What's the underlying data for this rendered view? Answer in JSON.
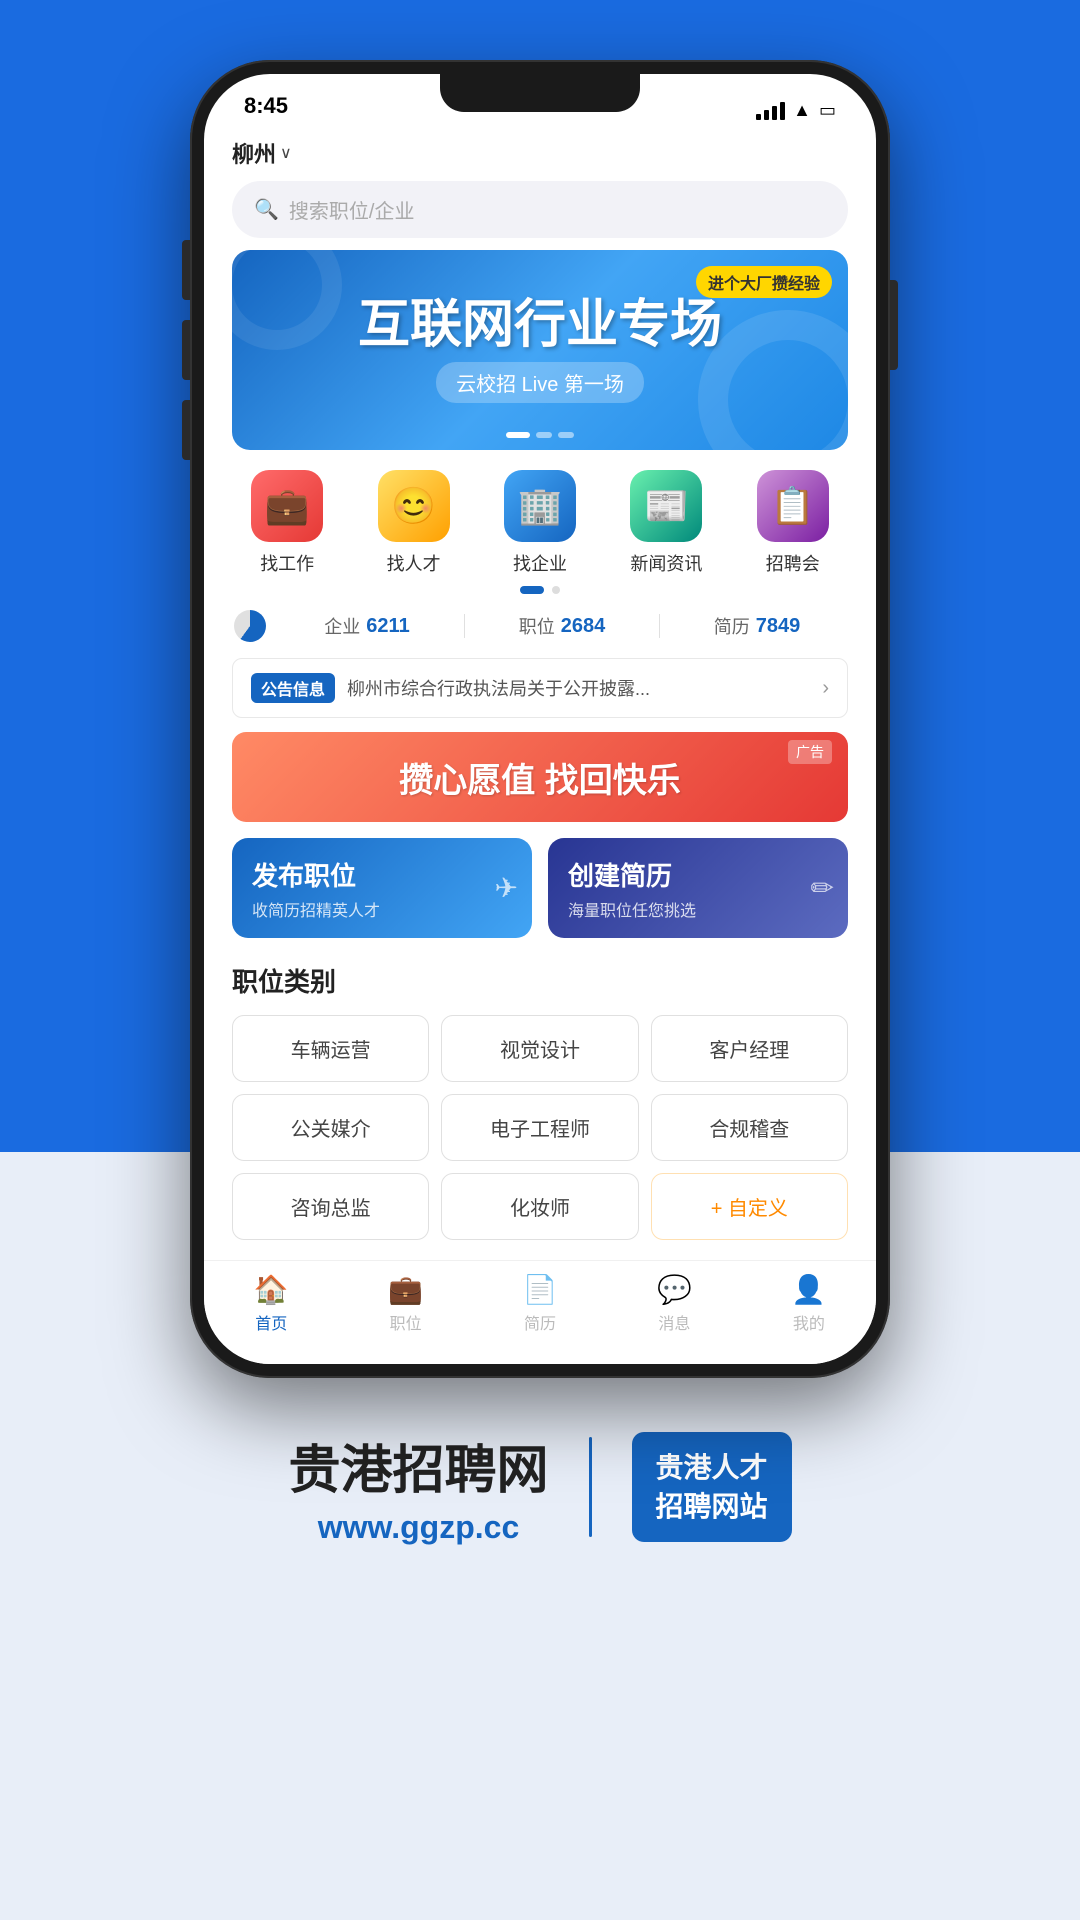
{
  "page": {
    "background_top": "#1a6be0",
    "background_bottom": "#e8eef8"
  },
  "status_bar": {
    "time": "8:45",
    "signal": "full",
    "wifi": "on",
    "battery": "full"
  },
  "header": {
    "location": "柳州",
    "chevron": "∨",
    "search_placeholder": "搜索职位/企业"
  },
  "banner": {
    "badge": "进个大厂攒经验",
    "main_text": "互联网行业专场",
    "sub_text": "云校招 Live 第一场"
  },
  "quick_icons": [
    {
      "label": "找工作",
      "icon": "💼"
    },
    {
      "label": "找人才",
      "icon": "😊"
    },
    {
      "label": "找企业",
      "icon": "🏢"
    },
    {
      "label": "新闻资讯",
      "icon": "📰"
    },
    {
      "label": "招聘会",
      "icon": "📋"
    }
  ],
  "stats": {
    "company_label": "企业",
    "company_value": "6211",
    "position_label": "职位",
    "position_value": "2684",
    "resume_label": "简历",
    "resume_value": "7849"
  },
  "notice": {
    "tag": "公告信息",
    "text": "柳州市综合行政执法局关于公开披露..."
  },
  "ad_banner": {
    "text": "攒心愿值 找回快乐",
    "badge": "广告"
  },
  "action_buttons": [
    {
      "title": "发布职位",
      "subtitle": "收简历招精英人才",
      "icon": "✈",
      "bg": "blue"
    },
    {
      "title": "创建简历",
      "subtitle": "海量职位任您挑选",
      "icon": "✏",
      "bg": "indigo"
    }
  ],
  "categories": {
    "section_title": "职位类别",
    "items": [
      "车辆运营",
      "视觉设计",
      "客户经理",
      "公关媒介",
      "电子工程师",
      "合规稽查",
      "咨询总监",
      "化妆师",
      "+ 自定义"
    ]
  },
  "bottom_nav": [
    {
      "label": "首页",
      "icon": "🏠",
      "active": true
    },
    {
      "label": "职位",
      "icon": "💼",
      "active": false
    },
    {
      "label": "简历",
      "icon": "📄",
      "active": false
    },
    {
      "label": "消息",
      "icon": "💬",
      "active": false
    },
    {
      "label": "我的",
      "icon": "👤",
      "active": false
    }
  ],
  "footer": {
    "brand_part1": "贵港",
    "brand_part2": "招聘网",
    "url": "www.ggzp.cc",
    "badge_line1": "贵港人才",
    "badge_line2": "招聘网站"
  }
}
